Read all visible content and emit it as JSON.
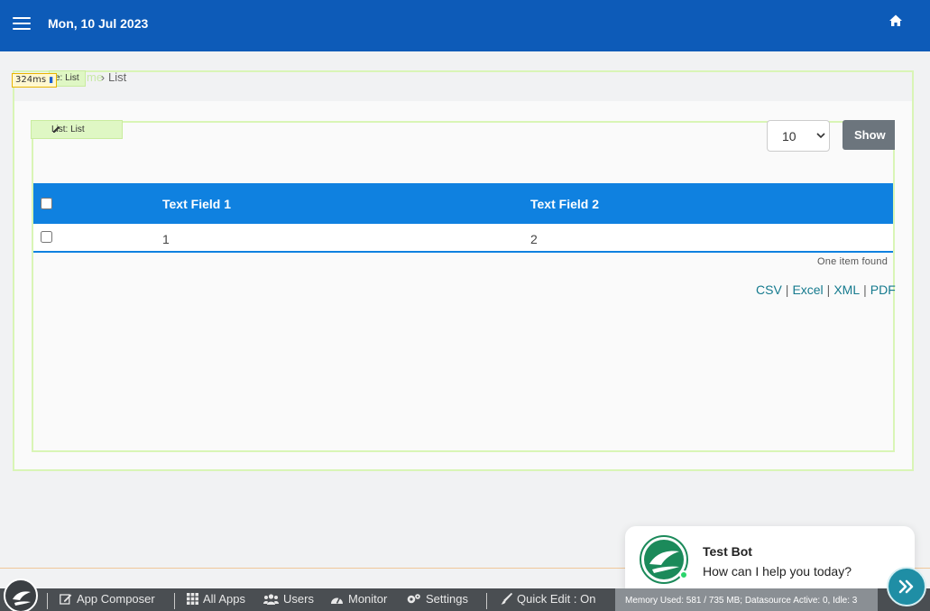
{
  "header": {
    "date": "Mon, 10 Jul 2023"
  },
  "breadcrumb": {
    "faint": "me",
    "current": "List"
  },
  "quick_edit": {
    "page_tag": "e: List",
    "list_tag": "List: List",
    "timer": "324ms"
  },
  "list": {
    "page_size": "10",
    "page_size_options": [
      "10"
    ],
    "show_label": "Show",
    "columns": [
      "Text Field 1",
      "Text Field 2"
    ],
    "rows": [
      {
        "field1": "1",
        "field2": "2"
      }
    ],
    "found_text": "One item found",
    "exports": [
      "CSV",
      "Excel",
      "XML",
      "PDF"
    ]
  },
  "bottombar": {
    "items": [
      "App Composer",
      "All Apps",
      "Users",
      "Monitor",
      "Settings",
      "Quick Edit : On"
    ],
    "memory": "Memory Used: 581 / 735 MB; Datasource Active: 0, Idle: 3"
  },
  "chat": {
    "name": "Test Bot",
    "message": "How can I help you today?"
  },
  "colors": {
    "header": "#0d5bb8",
    "table_header": "#0f81e0",
    "quick_edit_border": "#d9f5b6",
    "show_button": "#6c757d",
    "export_link": "#157a8e",
    "bottombar": "#4a4e52",
    "chat_button": "#1f8ea5"
  }
}
